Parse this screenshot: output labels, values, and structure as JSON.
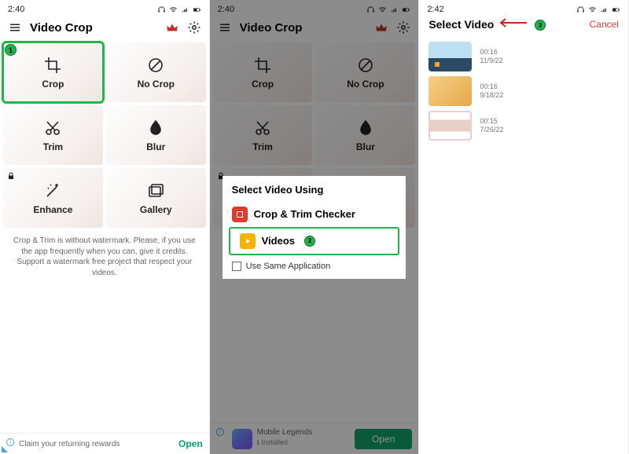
{
  "status": {
    "time1": "2:40",
    "time2": "2:40",
    "time3": "2:42"
  },
  "app": {
    "title": "Video Crop"
  },
  "tiles": {
    "crop": "Crop",
    "nocrop": "No Crop",
    "trim": "Trim",
    "blur": "Blur",
    "enhance": "Enhance",
    "gallery": "Gallery"
  },
  "footnote": "Crop & Trim is without watermark. Please, if you use the app frequently when you can, give it credits. Support a watermark free project that respect your videos.",
  "ad1": {
    "text": "Claim your returning rewards",
    "open": "Open"
  },
  "ad2": {
    "name": "Mobile Legends",
    "sub": "Installed",
    "open": "Open"
  },
  "dialog": {
    "title": "Select Video Using",
    "opt1": "Crop & Trim Checker",
    "opt2": "Videos",
    "check": "Use Same Application"
  },
  "select": {
    "title": "Select Video",
    "cancel": "Cancel",
    "videos": [
      {
        "dur": "00:16",
        "date": "11/9/22"
      },
      {
        "dur": "00:16",
        "date": "9/18/22"
      },
      {
        "dur": "00:15",
        "date": "7/26/22"
      }
    ]
  },
  "badges": {
    "b1": "1",
    "b2": "2",
    "b3": "3"
  }
}
